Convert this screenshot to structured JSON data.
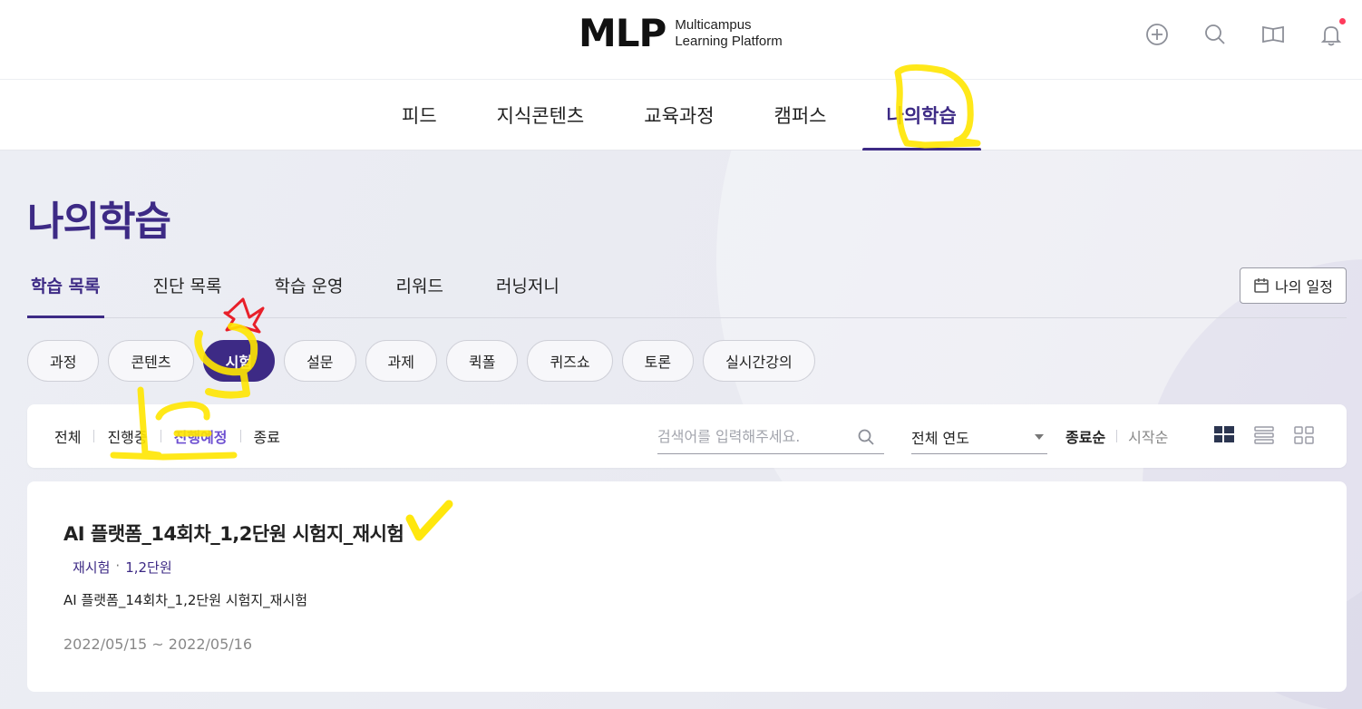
{
  "header": {
    "logo_mark": "MLP",
    "logo_line1": "Multicampus",
    "logo_line2": "Learning Platform",
    "icons": [
      "plus-circle-icon",
      "search-icon",
      "book-icon",
      "bell-icon"
    ]
  },
  "main_nav": {
    "items": [
      {
        "label": "피드",
        "active": false
      },
      {
        "label": "지식콘텐츠",
        "active": false
      },
      {
        "label": "교육과정",
        "active": false
      },
      {
        "label": "캠퍼스",
        "active": false
      },
      {
        "label": "나의학습",
        "active": true
      }
    ]
  },
  "page": {
    "title": "나의학습"
  },
  "sub_tabs": {
    "items": [
      {
        "label": "학습 목록",
        "active": true
      },
      {
        "label": "진단 목록",
        "active": false
      },
      {
        "label": "학습 운영",
        "active": false
      },
      {
        "label": "리워드",
        "active": false
      },
      {
        "label": "러닝저니",
        "active": false
      }
    ],
    "schedule_button": "나의 일정"
  },
  "chips": {
    "items": [
      {
        "label": "과정",
        "active": false
      },
      {
        "label": "콘텐츠",
        "active": false
      },
      {
        "label": "시험",
        "active": true
      },
      {
        "label": "설문",
        "active": false
      },
      {
        "label": "과제",
        "active": false
      },
      {
        "label": "퀵폴",
        "active": false
      },
      {
        "label": "퀴즈쇼",
        "active": false
      },
      {
        "label": "토론",
        "active": false
      },
      {
        "label": "실시간강의",
        "active": false
      }
    ]
  },
  "filters": {
    "status": [
      {
        "label": "전체",
        "active": false
      },
      {
        "label": "진행중",
        "active": false
      },
      {
        "label": "진행예정",
        "active": true
      },
      {
        "label": "종료",
        "active": false
      }
    ],
    "search_placeholder": "검색어를 입력해주세요.",
    "year_select": "전체 연도",
    "sort": [
      {
        "label": "종료순",
        "active": true
      },
      {
        "label": "시작순",
        "active": false
      }
    ],
    "view_icons": [
      "grid-view-icon",
      "list-view-icon",
      "tile-view-icon"
    ]
  },
  "card": {
    "title": "AI 플랫폼_14회차_1,2단원 시험지_재시험",
    "meta_type": "재시험",
    "meta_dot": "·",
    "meta_unit": "1,2단원",
    "description": "AI 플랫폼_14회차_1,2단원 시험지_재시험",
    "date_range": "2022/05/15 ~ 2022/05/16"
  },
  "colors": {
    "brand": "#3d2a85",
    "accent_text": "#6d4fd1",
    "highlight_marker": "#ffe600",
    "annotation_red": "#e8202a",
    "notification_dot": "#ff3b5c"
  }
}
